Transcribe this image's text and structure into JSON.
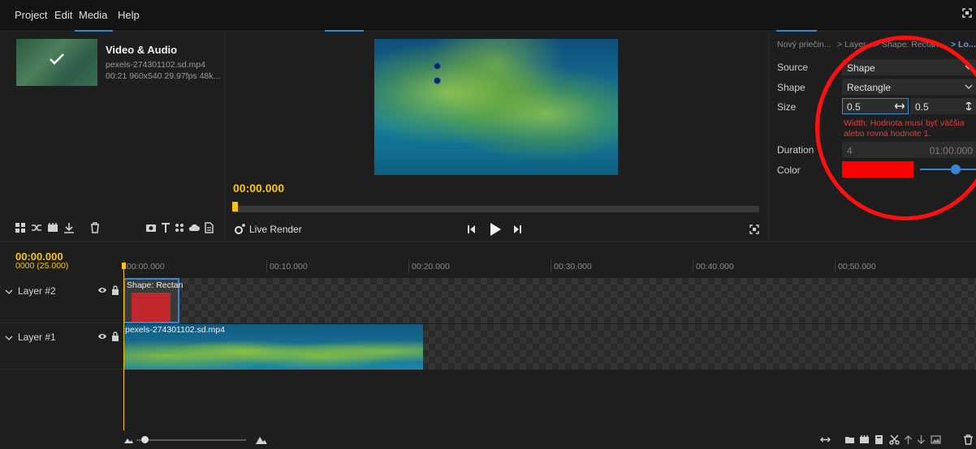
{
  "menu": {
    "items": [
      "Project",
      "Edit",
      "Media",
      "Help"
    ]
  },
  "media": {
    "item_title": "Video & Audio",
    "file_name": "pexels-274301102.sd.mp4",
    "file_info": "00:21 960x540 29.97fps 48k...",
    "tools": [
      "grid-icon",
      "shuffle-icon",
      "film-icon",
      "download-icon",
      "trash-icon",
      "camera-icon",
      "text-icon",
      "transitions-icon",
      "cloud-icon",
      "document-icon"
    ]
  },
  "preview": {
    "timecode": "00:00.000",
    "live_render_label": "Live Render"
  },
  "properties": {
    "breadcrumb": [
      "Nový priečin...",
      "> Layer ...",
      "> Shape: Rectan...",
      "> Lo..."
    ],
    "source_label": "Source",
    "source_value": "Shape",
    "shape_label": "Shape",
    "shape_value": "Rectangle",
    "size_label": "Size",
    "size_width": "0.5",
    "size_height": "0.5",
    "error": "Width: Hodnota musí byť väčšia alebo rovná hodnote 1.",
    "duration_label": "Duration",
    "duration_value": "4",
    "duration_end": "01:00.000",
    "color_label": "Color",
    "color_value": "#ff0000",
    "accent_color": "#3a86d6",
    "annotation_color": "#ff1010"
  },
  "timeline": {
    "timecode": "00:00.000",
    "frame_info": "0000 (25.000)",
    "ticks": [
      "00:00.000",
      "00:10.000",
      "00:20.000",
      "00:30.000",
      "00:40.000",
      "00:50.000"
    ],
    "layers": [
      {
        "name": "Layer #2",
        "clip": "Shape: Rectan"
      },
      {
        "name": "Layer #1",
        "clip": "pexels-274301102.sd.mp4"
      }
    ],
    "playhead_color": "#f5c518"
  }
}
